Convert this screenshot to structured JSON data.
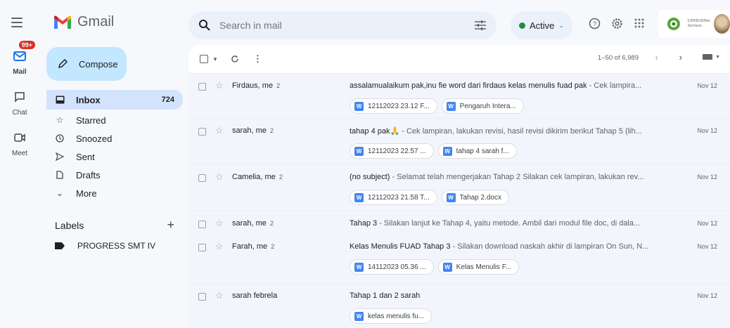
{
  "header": {
    "app_name": "Gmail",
    "search_placeholder": "Search in mail",
    "status_label": "Active",
    "org_line1": "UINSGDNet",
    "org_line2": "Services"
  },
  "rail": [
    {
      "label": "Mail",
      "badge": "99+"
    },
    {
      "label": "Chat"
    },
    {
      "label": "Meet"
    }
  ],
  "sidebar": {
    "compose_label": "Compose",
    "items": [
      {
        "label": "Inbox",
        "count": "724"
      },
      {
        "label": "Starred"
      },
      {
        "label": "Snoozed"
      },
      {
        "label": "Sent"
      },
      {
        "label": "Drafts"
      },
      {
        "label": "More"
      }
    ],
    "labels_heading": "Labels",
    "labels_add": "+",
    "labels": [
      {
        "label": "PROGRESS SMT IV"
      }
    ]
  },
  "toolbar": {
    "range": "1–50 of 6,989"
  },
  "emails": [
    {
      "sender": "Firdaus, me",
      "count": "2",
      "subject": "assalamualaikum pak,inu fie word dari firdaus kelas menulis fuad pak",
      "snippet": " - Cek lampira...",
      "date": "Nov 12",
      "attachments": [
        "12112023 23.12 F...",
        "Pengaruh Intera..."
      ]
    },
    {
      "sender": "sarah, me",
      "count": "2",
      "subject": "tahap 4 pak🙏",
      "snippet": " - Cek lampiran, lakukan revisi, hasil revisi dikirim berikut Tahap 5 (lih...",
      "date": "Nov 12",
      "attachments": [
        "12112023 22.57 ...",
        "tahap 4 sarah f..."
      ]
    },
    {
      "sender": "Camelia, me",
      "count": "2",
      "subject": "(no subject)",
      "snippet": " - Selamat telah mengerjakan Tahap 2 Silakan cek lampiran, lakukan rev...",
      "date": "Nov 12",
      "attachments": [
        "12112023 21.58 T...",
        "Tahap 2.docx"
      ]
    },
    {
      "sender": "sarah, me",
      "count": "2",
      "subject": "Tahap 3",
      "snippet": " - Silakan lanjut ke Tahap 4, yaitu metode. Ambil dari modul file doc, di dala...",
      "date": "Nov 12",
      "attachments": []
    },
    {
      "sender": "Farah, me",
      "count": "2",
      "subject": "Kelas Menulis FUAD Tahap 3",
      "snippet": " - Silakan download naskah akhir di lampiran On Sun, N...",
      "date": "Nov 12",
      "attachments": [
        "14112023 05.36 ...",
        "Kelas Menulis F..."
      ]
    },
    {
      "sender": "sarah febrela",
      "count": "",
      "subject": "Tahap 1 dan 2 sarah",
      "snippet": "",
      "date": "Nov 12",
      "attachments": [
        "kelas menulis fu..."
      ]
    }
  ],
  "colors": {
    "background": "#f6f8fc",
    "compose": "#c2e7ff",
    "inbox_active": "#d3e3fd",
    "badge": "#d93025",
    "active_status": "#1e8e3e",
    "word_icon": "#4285f4"
  }
}
